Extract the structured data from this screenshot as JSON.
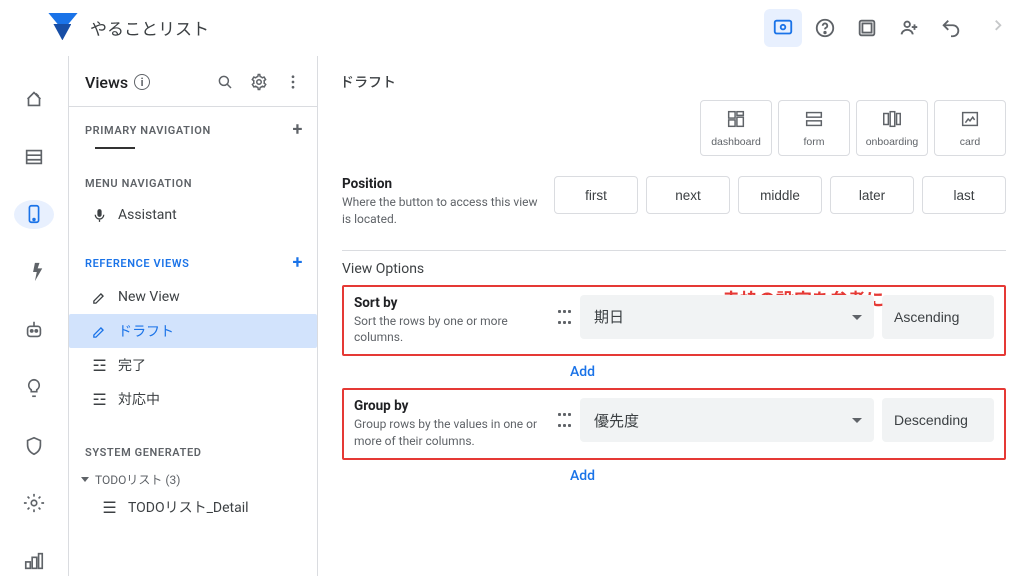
{
  "app": {
    "title": "やることリスト"
  },
  "header_icons": {
    "preview": "preview-icon",
    "help": "help-icon",
    "grid": "grid-icon",
    "share": "share-icon",
    "undo": "undo-icon",
    "redo": "redo-icon"
  },
  "rail": [
    {
      "name": "home-icon"
    },
    {
      "name": "data-icon"
    },
    {
      "name": "views-icon",
      "active": true
    },
    {
      "name": "actions-icon"
    },
    {
      "name": "bot-icon"
    },
    {
      "name": "idea-icon"
    },
    {
      "name": "security-icon"
    },
    {
      "name": "settings-icon"
    },
    {
      "name": "manage-icon"
    }
  ],
  "panel": {
    "title": "Views",
    "sections": {
      "primary": "PRIMARY NAVIGATION",
      "menu": "MENU NAVIGATION",
      "reference": "REFERENCE VIEWS",
      "system": "SYSTEM GENERATED"
    },
    "menu_items": [
      {
        "icon": "mic",
        "label": "Assistant"
      }
    ],
    "reference_items": [
      {
        "icon": "edit",
        "label": "New View"
      },
      {
        "icon": "edit",
        "label": "ドラフト",
        "active": true
      },
      {
        "icon": "list",
        "label": "完了"
      },
      {
        "icon": "list",
        "label": "対応中"
      }
    ],
    "system_group": {
      "label": "TODOリスト (3)",
      "items": [
        {
          "icon": "detail",
          "label": "TODOリスト_Detail"
        }
      ]
    }
  },
  "main": {
    "breadcrumb": "ドラフト",
    "annotation": "赤枠の設定を参考に",
    "view_types": [
      {
        "id": "dashboard",
        "label": "dashboard"
      },
      {
        "id": "form",
        "label": "form"
      },
      {
        "id": "onboarding",
        "label": "onboarding"
      },
      {
        "id": "card",
        "label": "card"
      }
    ],
    "position": {
      "title": "Position",
      "desc": "Where the button to access this view is located.",
      "options": [
        "first",
        "next",
        "middle",
        "later",
        "last"
      ]
    },
    "view_options_header": "View Options",
    "sort": {
      "title": "Sort by",
      "desc": "Sort the rows by one or more columns.",
      "column": "期日",
      "order": "Ascending",
      "add": "Add"
    },
    "group": {
      "title": "Group by",
      "desc": "Group rows by the values in one or more of their columns.",
      "column": "優先度",
      "order": "Descending",
      "add": "Add"
    }
  }
}
